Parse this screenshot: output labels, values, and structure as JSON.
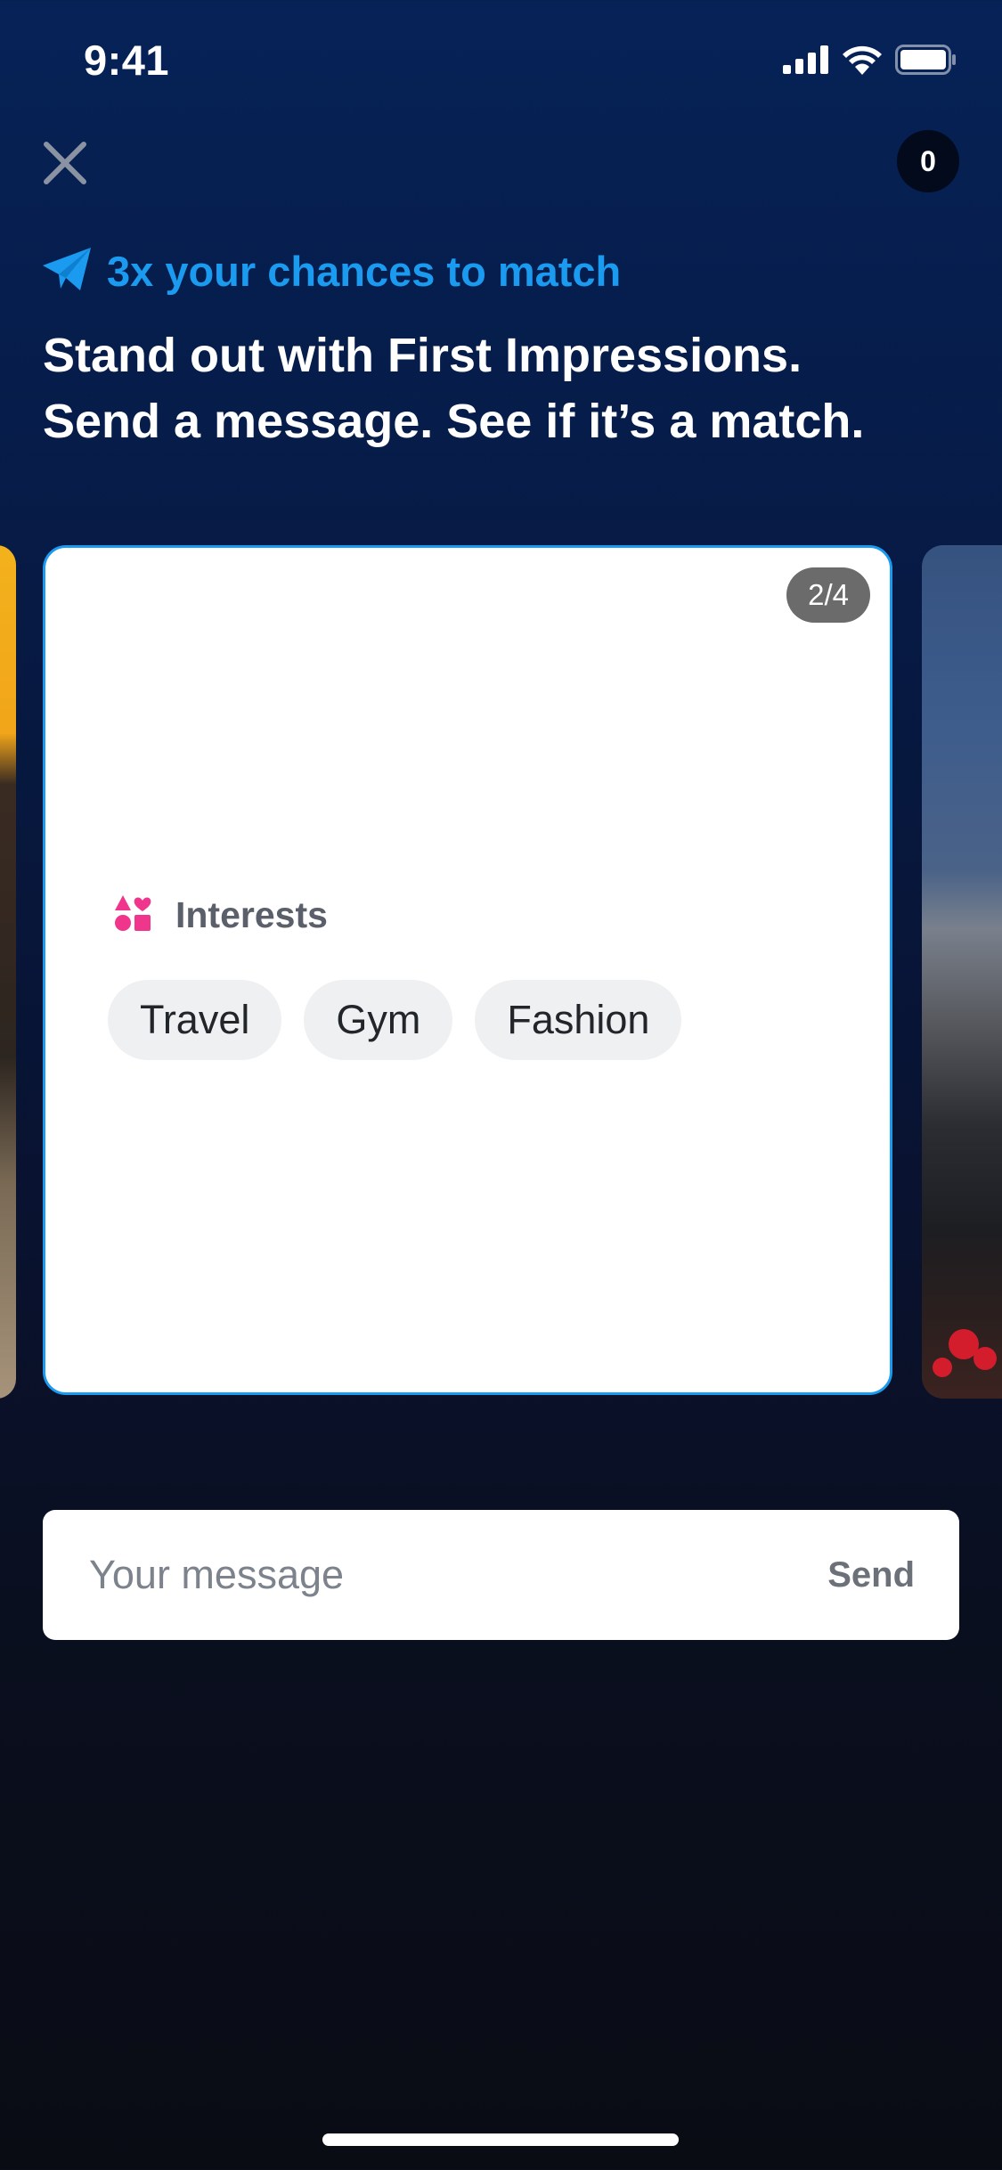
{
  "status_bar": {
    "time": "9:41"
  },
  "header": {
    "close_icon": "close-icon",
    "counter": "0"
  },
  "promo": {
    "icon": "paper-plane-icon",
    "text": "3x your chances to match",
    "color": "#1a9bf0"
  },
  "headline": {
    "line1": "Stand out with First Impressions.",
    "line2": "Send a message. See if it’s a match."
  },
  "card": {
    "page_indicator": "2/4",
    "section": {
      "icon": "interests-shapes-icon",
      "label": "Interests"
    },
    "chips": [
      "Travel",
      "Gym",
      "Fashion"
    ]
  },
  "message": {
    "placeholder": "Your message",
    "value": "",
    "send_label": "Send"
  },
  "colors": {
    "accent": "#1a9bf0",
    "interests_icon": "#f0368c",
    "background_top": "#062257",
    "background_bottom": "#0a0c14"
  }
}
